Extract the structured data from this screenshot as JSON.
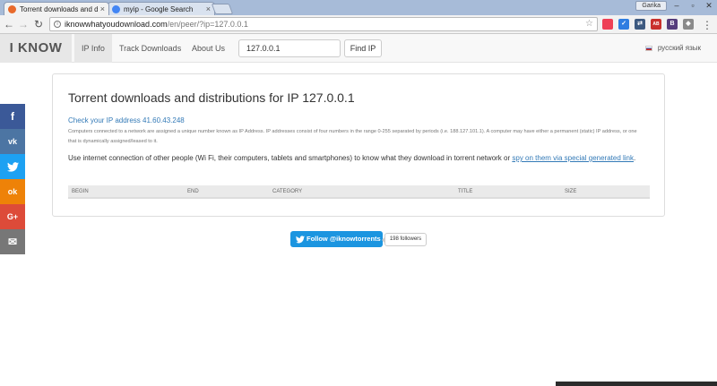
{
  "browser": {
    "tabs": [
      {
        "label": "Torrent downloads and d",
        "active": true,
        "favicon_color": "#e86a2c"
      },
      {
        "label": "myip - Google Search",
        "active": false,
        "favicon_color": "#4285f4"
      }
    ],
    "user_name": "Garika",
    "url_host": "iknowwhatyoudownload.com",
    "url_path": "/en/peer/?ip=127.0.0.1",
    "extensions": [
      {
        "icon": "pocket-icon",
        "color": "#ee4056",
        "glyph": ""
      },
      {
        "icon": "checklist-icon",
        "color": "#2f7de1",
        "glyph": "✓"
      },
      {
        "icon": "arrows-icon",
        "color": "#3d5a80",
        "glyph": "⇄"
      },
      {
        "icon": "adblock-icon",
        "color": "#c9302c",
        "glyph": "AB"
      },
      {
        "icon": "bootstrap-icon",
        "color": "#563d7c",
        "glyph": "B"
      },
      {
        "icon": "puzzle-icon",
        "color": "#8a8a8a",
        "glyph": "◆"
      }
    ]
  },
  "site": {
    "brand": "I KNOW",
    "nav": [
      {
        "label": "IP Info",
        "active": true
      },
      {
        "label": "Track Downloads",
        "active": false
      },
      {
        "label": "About Us",
        "active": false
      }
    ],
    "ip_input_value": "127.0.0.1",
    "find_button": "Find IP",
    "language": "русский язык"
  },
  "social": [
    {
      "icon": "facebook-icon",
      "glyph": "f",
      "color": "#3b5998"
    },
    {
      "icon": "vk-icon",
      "glyph": "vk",
      "color": "#4c75a3"
    },
    {
      "icon": "twitter-icon",
      "glyph": "🐦",
      "color": "#1da1f2"
    },
    {
      "icon": "odnoklassniki-icon",
      "glyph": "ok",
      "color": "#ee8208"
    },
    {
      "icon": "google-plus-icon",
      "glyph": "G+",
      "color": "#dd4b39"
    },
    {
      "icon": "email-icon",
      "glyph": "✉",
      "color": "#777777"
    }
  ],
  "main": {
    "title": "Torrent downloads and distributions for IP 127.0.0.1",
    "check_ip_link": "Check your IP address 41.60.43.248",
    "explanation": "Computers connected to a network are assigned a unique number known as IP Address. IP addresses consist of four numbers in the range 0-255 separated by periods (i.e. 188.127.101.1). A computer may have either a permanent (static) IP address, or one that is dynamically assigned/leased to it.",
    "usage_text": "Use internet connection of other people (Wi Fi, their computers, tablets and smartphones) to know what they download in torrent network or ",
    "spy_link": "spy on them via special generated link",
    "usage_end": ".",
    "table_headers": [
      "BEGIN",
      "END",
      "CATEGORY",
      "TITLE",
      "SIZE"
    ]
  },
  "twitter": {
    "follow_label": "Follow @iknowtorrents",
    "followers": "198 followers"
  }
}
